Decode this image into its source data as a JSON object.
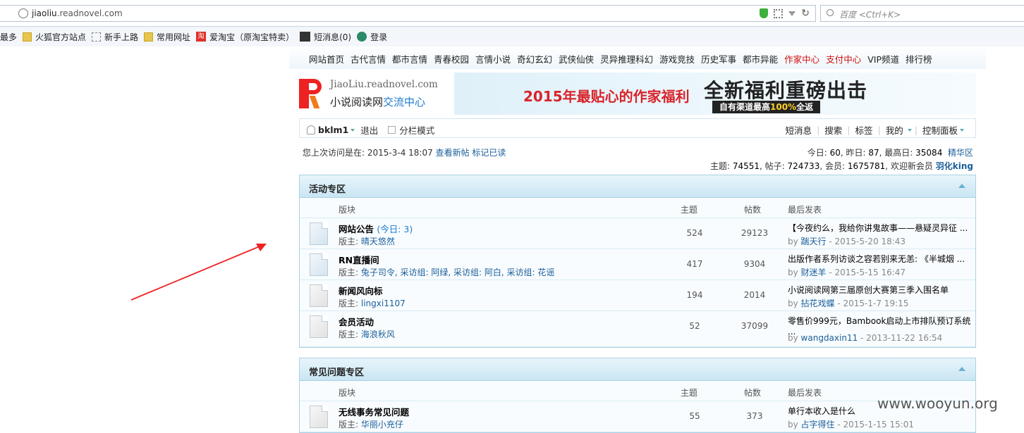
{
  "browser": {
    "url_domain": "jiaoliu",
    "url_rest": ".readnovel.com",
    "search_placeholder": "百度 <Ctrl+K>",
    "bookmarks": [
      "最多",
      "火狐官方站点",
      "新手上路",
      "常用网址",
      "爱淘宝（原淘宝特卖）",
      "短消息(0)",
      "登录"
    ],
    "taobao_icon": "淘"
  },
  "topnav": {
    "links": [
      "网站首页",
      "古代言情",
      "都市言情",
      "青春校园",
      "言情小说",
      "奇幻玄幻",
      "武侠仙侠",
      "灵异推理科幻",
      "游戏竞技",
      "历史军事",
      "都市异能",
      "作家中心",
      "支付中心",
      "VIP频道",
      "排行榜"
    ],
    "red_indices": [
      11,
      12
    ]
  },
  "logo": {
    "domain": "JiaoLiu.readnovel.com",
    "title_black": "小说阅读网",
    "title_blue": "交流中心"
  },
  "banner": {
    "headline": "2015年最贴心的作家福利",
    "big": "全新福利重磅出击",
    "sub_pre": "自有渠道最高",
    "sub_pct": "100%",
    "sub_post": "全返"
  },
  "userbar": {
    "username": "bklm1",
    "logout": "退出",
    "split_mode": "分栏模式",
    "right_links": [
      "短消息",
      "搜索",
      "标签",
      "我的",
      "控制面板"
    ]
  },
  "info": {
    "lastvisit_label": "您上次访问是在: 2015-3-4 18:07",
    "view_new": "查看新帖",
    "mark_read": "标记已读",
    "today_label": "今日:",
    "today": "60",
    "yesterday_label": ", 昨日:",
    "yesterday": "87",
    "highest_label": ", 最高日:",
    "highest": "35084",
    "digest": "精华区",
    "threads_label": "主题:",
    "threads": "74551",
    "posts_label": ", 帖子:",
    "posts": "724733",
    "members_label": ", 会员:",
    "members": "1675781",
    "welcome_label": ", 欢迎新会员",
    "newest_member": "羽化king"
  },
  "columns": {
    "forum": "版块",
    "threads": "主题",
    "posts": "帖数",
    "last": "最后发表"
  },
  "sections": [
    {
      "title": "活动专区",
      "forums": [
        {
          "name": "网站公告",
          "today": "(今日: 3)",
          "mods_label": "版主:",
          "mods": "晴天悠然",
          "threads": "524",
          "posts": "29123",
          "last": "【今夜约么，我给你讲鬼故事——悬疑灵异征 ...",
          "by_label": "by",
          "by": "踹天行",
          "date": " - 2015-5-20 18:43"
        },
        {
          "name": "RN直播间",
          "today": "",
          "mods_label": "版主:",
          "mods": "兔子司令, 采访组: 阿绿, 采访组: 阿白, 采访组: 花谣",
          "threads": "417",
          "posts": "9304",
          "last": "出版作者系列访谈之容若别来无恙: 《半城烟 ...",
          "by_label": "by",
          "by": "财迷羊",
          "date": " - 2015-5-15 16:47"
        },
        {
          "name": "新闻风向标",
          "today": "",
          "mods_label": "版主:",
          "mods": "lingxi1107",
          "threads": "194",
          "posts": "2014",
          "last": "小说阅读网第三届原创大赛第三季入围名单",
          "by_label": "by",
          "by": "拈花戏蝶",
          "date": " - 2015-1-7 19:15"
        },
        {
          "name": "会员活动",
          "today": "",
          "mods_label": "版主:",
          "mods": "海浪秋风",
          "threads": "52",
          "posts": "37099",
          "last": "零售价999元，Bambook启动上市排队预订系统",
          "last2": "...",
          "by_label": "by",
          "by": "wangdaxin11",
          "date": " - 2013-11-22 16:54"
        }
      ]
    },
    {
      "title": "常见问题专区",
      "forums": [
        {
          "name": "无线事务常见问题",
          "today": "",
          "mods_label": "版主:",
          "mods": "华丽小充仔",
          "threads": "55",
          "posts": "373",
          "last": "单行本收入是什么",
          "by_label": "by",
          "by": "占字得住",
          "date": " - 2015-1-15 15:01"
        }
      ]
    }
  ],
  "watermark": "www.wooyun.org"
}
